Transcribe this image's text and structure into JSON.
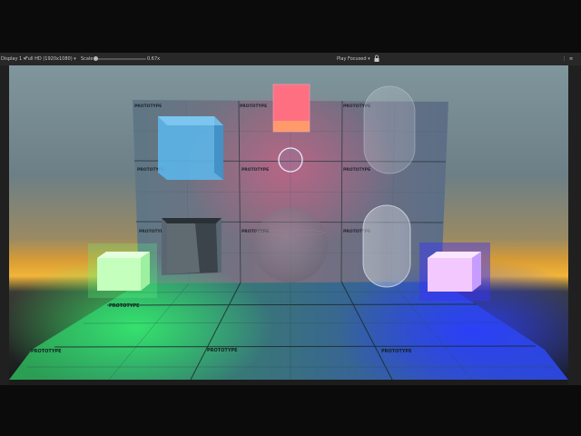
{
  "game_view": {
    "display_label": "Display 1",
    "resolution_label": "Full HD (1920x1080)",
    "scale_label": "Scale",
    "scale_value": "0.67x",
    "play_mode_label": "Play Focused"
  },
  "scene": {
    "texture_label": "PROTOTYPE",
    "colors": {
      "red_cube": "#ff6b7c",
      "blue_cube": "#56b4ec",
      "green_cube": "#b8ffb0",
      "pink_cube": "#f4c8ff",
      "green_light": "#2fd35a",
      "blue_light": "#1f3cff"
    }
  },
  "icons": [
    "chevron-down-icon",
    "lock-icon",
    "menu-icon",
    "dropdown-icon"
  ]
}
